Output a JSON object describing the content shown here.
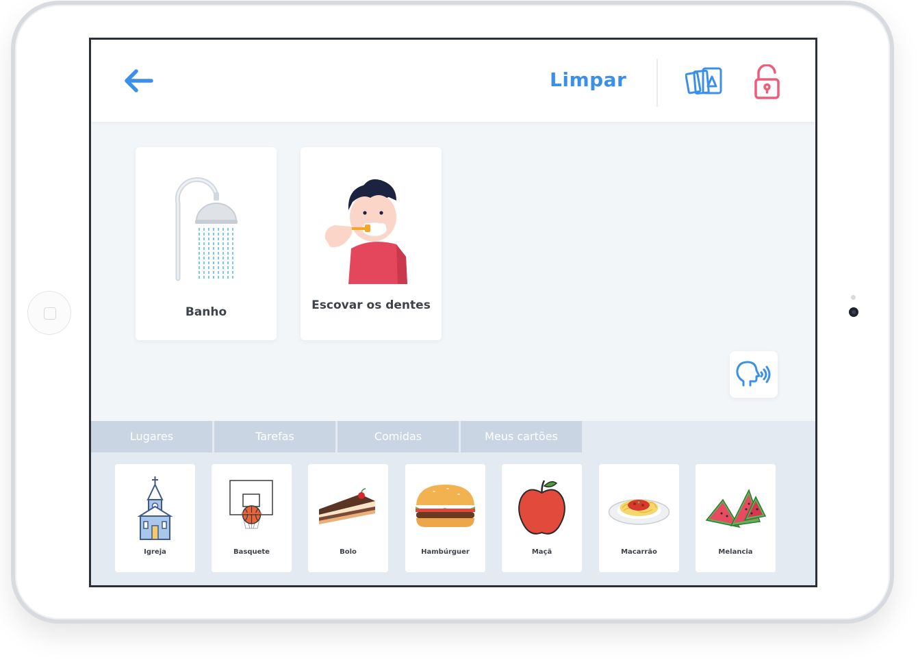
{
  "header": {
    "back_icon": "arrow-left-icon",
    "clear_label": "Limpar",
    "cards_icon": "cards-stack-icon",
    "lock_icon": "unlock-icon",
    "accent_color": "#3a90e8",
    "lock_color": "#ef5b7b"
  },
  "sentence": {
    "cards": [
      {
        "label": "Banho",
        "icon": "shower-icon"
      },
      {
        "label": "Escovar os dentes",
        "icon": "boy-brushing-teeth-icon"
      }
    ],
    "speak_icon": "speaking-head-icon"
  },
  "tabs": [
    {
      "label": "Lugares"
    },
    {
      "label": "Tarefas"
    },
    {
      "label": "Comidas"
    },
    {
      "label": "Meus cartões"
    }
  ],
  "palette": {
    "cards": [
      {
        "label": "Igreja",
        "icon": "church-icon"
      },
      {
        "label": "Basquete",
        "icon": "basketball-hoop-icon"
      },
      {
        "label": "Bolo",
        "icon": "cake-slice-icon"
      },
      {
        "label": "Hambúrguer",
        "icon": "hamburger-icon"
      },
      {
        "label": "Maçã",
        "icon": "apple-icon"
      },
      {
        "label": "Macarrão",
        "icon": "spaghetti-icon"
      },
      {
        "label": "Melancia",
        "icon": "watermelon-icon"
      }
    ]
  }
}
